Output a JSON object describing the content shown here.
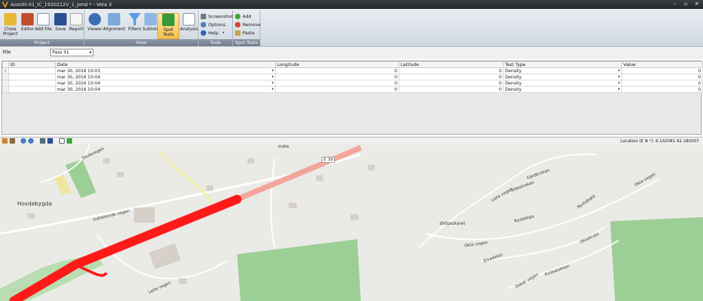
{
  "window": {
    "title": "Avsnitt-01_IC_1920212V_1_pmd * - Veta 3"
  },
  "ribbon": {
    "groups": [
      {
        "label": "Project",
        "buttons": [
          "Close Project",
          "Editor",
          "Add File",
          "Save",
          "Report"
        ]
      },
      {
        "label": "View",
        "buttons": [
          "Viewer",
          "Alignment",
          "Filters",
          "Sublots",
          "Spot Tests",
          "Analysis"
        ]
      },
      {
        "label": "Tools",
        "buttons": [
          "Screenshot",
          "Options",
          "Help"
        ]
      },
      {
        "label": "Spot Tests",
        "buttons": [
          "Add",
          "Remove",
          "Paste"
        ]
      }
    ]
  },
  "file": {
    "label": "File",
    "selected": "Pass 01"
  },
  "grid": {
    "columns": [
      "ID",
      "Date",
      "Longitude",
      "Latitude",
      "Test Type",
      "Value"
    ],
    "rows": [
      {
        "date": "mar 30, 2016 10:03",
        "longitude": "0",
        "latitude": "0",
        "type": "Density",
        "value": "0"
      },
      {
        "date": "mar 30, 2016 10:04",
        "longitude": "0",
        "latitude": "0",
        "type": "Density",
        "value": "0"
      },
      {
        "date": "mar 30, 2016 10:04",
        "longitude": "0",
        "latitude": "0",
        "type": "Density",
        "value": "0"
      },
      {
        "date": "mar 30, 2016 10:04",
        "longitude": "0",
        "latitude": "0",
        "type": "Density",
        "value": "0"
      }
    ]
  },
  "map": {
    "location": "Location (E N °): 6.102081 62.185007",
    "labels": {
      "hovdebygda": "Hovdebygda",
      "skulevegen": "Skulevegen",
      "indrehovde": "Indrehovde vegen",
      "e39": "E 39",
      "leite": "Leite vegen",
      "leite2": "Leite vegen",
      "gardkrokan": "Gardkrokan",
      "sideskrokan": "Sideskrokan",
      "okla1": "Okla vegen",
      "okla2": "Okla vegen",
      "rystelega": "Rystelega",
      "rystebakk": "Rystebakk",
      "oslipsskaret": "Øslipsskaret",
      "elvadalen": "Elvadalen",
      "oklabruta": "Oklabruta",
      "oskarvegen": "Oskar vegen",
      "kvilestokken": "Kvilestokken",
      "indre": "Indre"
    }
  },
  "colors": {
    "track": "#ff1a1a",
    "trackFaded": "#f4a59a",
    "park": "#9ccf95",
    "building": "#d6d0c8"
  }
}
